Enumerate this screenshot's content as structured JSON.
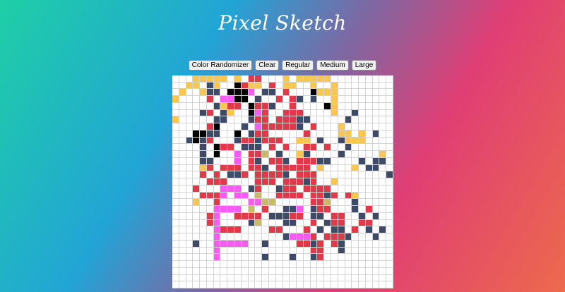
{
  "app": {
    "title": "Pixel Sketch"
  },
  "toolbar": {
    "buttons": [
      "Color Randomizer",
      "Clear",
      "Regular",
      "Medium",
      "Large"
    ]
  },
  "grid": {
    "columns": 32,
    "rows": 31,
    "palette": {
      "Y": "#f9c74f",
      "K": "#000000",
      "R": "#e03a4a",
      "P": "#f75cf2",
      "N": "#3d4a68",
      "O": "#c9bb63"
    },
    "pattern": [
      "...YYYYY.Y.RR...Y.YYYYY.........",
      "..YY.NY..KRYY.R.YY..Y..Y........",
      ".Y..YNN.KKKP.NN.R...KYYY........",
      "Y....R.PPKK.N..R.RN.N..Y........",
      "......NYRR.KRRN..R....KY........",
      "....NR.NY..KPR..RRR....Y..N.....",
      "Y.....NN...NRR.RRRNN.....N......",
      ".....RK...N.PRRRRRN.R...Y.......",
      "...KKNN..K.NRR.....R....YY.Y.N..",
      "..NKNR...NRRNRRR..YY.N..NYYY....",
      "....N.KRR.NNN.R.R..RR.R..N......",
      "....N.K..P.RRO.N..YN....N.....Y.",
      "....NN...P.RN.RRN.RRRNN....N.NN.",
      "....YR.RRR.RRN.RRRRR.Y....Y.NN..",
      "....R.R.NNR.RRRRN.RRR..........N",
      ".....RRR....RRR.RRRNR..Y........",
      "...R...PPP.NR..NRR.RRRR.........",
      "....RRRP.PP.O..RRRR.RRNR.RY.....",
      "...Y..R....PPOO.....RRO...N.....",
      "......PPPP.O.R..NNP.NRR...N.R...",
      ".....RP..RRRR.NNNRR.NN.RR..N.N..",
      ".....RP....NO...NN..R.NRR..RR...",
      "......PRRR....RR...R.N.NN.R.N.N.",
      "......P.........NPPPR.RRRN...N..",
      "...N..PPPPP..N....RRNR.RN.......",
      "......P.............RR..N.......",
      "......P......N...N..NR.........."
    ]
  }
}
